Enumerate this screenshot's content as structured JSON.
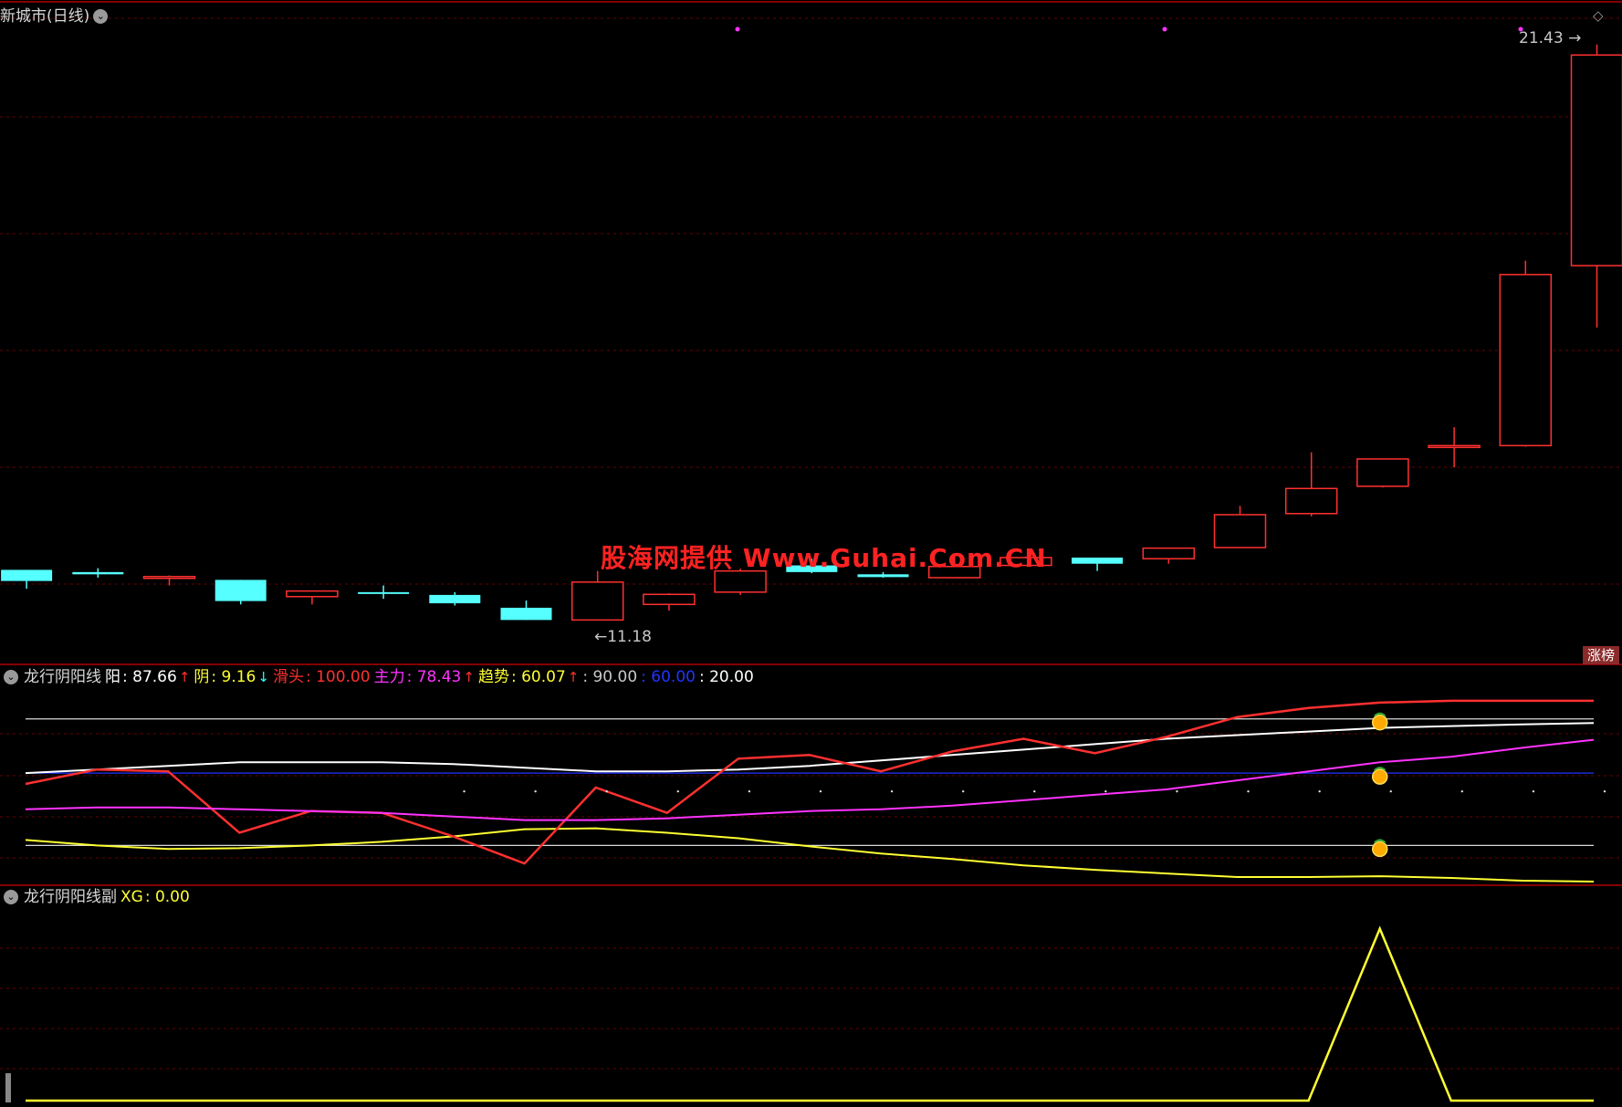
{
  "main": {
    "title": "新城市(日线)",
    "high_label": "21.43",
    "low_label": "←11.18",
    "watermark": "股海网提供 Www.Guhai.Com.CN",
    "badge": "涨榜"
  },
  "ind1": {
    "name": "龙行阴阳线",
    "items": [
      {
        "label": "阳",
        "value": "87.66",
        "arrow": "↑",
        "color": "#ffffff",
        "arrow_color": "#ff3030"
      },
      {
        "label": "阴",
        "value": "9.16",
        "arrow": "↓",
        "color": "#ffff33",
        "arrow_color": "#33ffff"
      },
      {
        "label": "滑头",
        "value": "100.00",
        "arrow": "",
        "color": "#ff3030",
        "arrow_color": "#ff3030"
      },
      {
        "label": "主力",
        "value": "78.43",
        "arrow": "↑",
        "color": "#ff33ff",
        "arrow_color": "#ff3030"
      },
      {
        "label": "趋势",
        "value": "60.07",
        "arrow": "↑",
        "color": "#ffff33",
        "arrow_color": "#ff3030"
      }
    ],
    "levels": [
      {
        "text": "90.00",
        "color": "#c8c8c8"
      },
      {
        "text": "60.00",
        "color": "#2233ff"
      },
      {
        "text": "20.00",
        "color": "#ffffff"
      }
    ]
  },
  "ind2": {
    "name": "龙行阴阳线副",
    "items": [
      {
        "label": "XG",
        "value": "0.00",
        "color": "#ffff33"
      }
    ]
  },
  "colors": {
    "up": "#ff3030",
    "down": "#55ffff",
    "grid": "#6a0000",
    "separator": "#b00000"
  },
  "chart_data": [
    {
      "type": "candlestick",
      "title": "新城市(日线)",
      "ylim": [
        10.5,
        21.9
      ],
      "annotations": [
        {
          "text": "21.43",
          "at": "max-high"
        },
        {
          "text": "11.18",
          "at": "min-low"
        }
      ],
      "candles": [
        {
          "o": 12.0,
          "h": 12.0,
          "l": 11.66,
          "c": 11.8
        },
        {
          "o": 11.96,
          "h": 12.03,
          "l": 11.86,
          "c": 11.92
        },
        {
          "o": 11.86,
          "h": 11.9,
          "l": 11.72,
          "c": 11.88
        },
        {
          "o": 11.82,
          "h": 11.82,
          "l": 11.38,
          "c": 11.44
        },
        {
          "o": 11.52,
          "h": 11.62,
          "l": 11.38,
          "c": 11.62
        },
        {
          "o": 11.6,
          "h": 11.72,
          "l": 11.48,
          "c": 11.58
        },
        {
          "o": 11.55,
          "h": 11.6,
          "l": 11.36,
          "c": 11.4
        },
        {
          "o": 11.32,
          "h": 11.45,
          "l": 11.1,
          "c": 11.1
        },
        {
          "o": 11.1,
          "h": 11.98,
          "l": 11.1,
          "c": 11.78
        },
        {
          "o": 11.38,
          "h": 11.58,
          "l": 11.27,
          "c": 11.56
        },
        {
          "o": 11.6,
          "h": 12.02,
          "l": 11.55,
          "c": 11.98
        },
        {
          "o": 12.08,
          "h": 12.2,
          "l": 11.94,
          "c": 11.96
        },
        {
          "o": 11.92,
          "h": 11.96,
          "l": 11.86,
          "c": 11.87
        },
        {
          "o": 11.86,
          "h": 12.26,
          "l": 11.86,
          "c": 12.06
        },
        {
          "o": 12.08,
          "h": 12.24,
          "l": 12.08,
          "c": 12.22
        },
        {
          "o": 12.22,
          "h": 12.22,
          "l": 11.98,
          "c": 12.11
        },
        {
          "o": 12.2,
          "h": 12.36,
          "l": 12.11,
          "c": 12.39
        },
        {
          "o": 12.4,
          "h": 13.15,
          "l": 12.4,
          "c": 12.99
        },
        {
          "o": 13.01,
          "h": 14.11,
          "l": 12.96,
          "c": 13.46
        },
        {
          "o": 13.5,
          "h": 13.98,
          "l": 13.48,
          "c": 13.99
        },
        {
          "o": 14.23,
          "h": 14.56,
          "l": 13.84,
          "c": 14.23
        },
        {
          "o": 14.23,
          "h": 17.55,
          "l": 14.21,
          "c": 17.3
        },
        {
          "o": 17.46,
          "h": 21.43,
          "l": 16.35,
          "c": 21.24
        }
      ]
    },
    {
      "type": "line",
      "title": "龙行阴阳线",
      "ylim": [
        0,
        105
      ],
      "reference_lines": [
        90,
        60,
        20
      ],
      "markers_at_index": 19,
      "series": [
        {
          "name": "阳",
          "color": "#ffffff",
          "values": [
            60,
            62,
            64,
            66,
            66,
            66,
            65,
            63,
            61,
            61,
            62,
            64,
            67,
            70,
            73,
            76,
            79,
            81,
            83,
            85,
            86,
            87,
            87.66
          ]
        },
        {
          "name": "阴",
          "color": "#ffff33",
          "values": [
            23,
            20,
            18,
            18.5,
            20,
            22,
            25,
            29,
            29.5,
            27,
            24,
            19.5,
            15.5,
            12.5,
            9,
            6.5,
            4.5,
            2.5,
            2.5,
            3,
            2,
            0.5,
            0
          ]
        },
        {
          "name": "滑头",
          "color": "#ff3030",
          "values": [
            54,
            62,
            61,
            27,
            39,
            38,
            25,
            10,
            52,
            38,
            68,
            70,
            61,
            72,
            79,
            71,
            80,
            91,
            96,
            99,
            100,
            100,
            100
          ]
        },
        {
          "name": "主力",
          "color": "#ff33ff",
          "values": [
            40,
            41,
            41,
            40,
            39,
            38,
            36,
            34,
            34,
            35,
            37,
            39,
            40,
            42,
            45,
            48,
            51,
            56,
            61,
            66,
            69,
            74,
            78.43
          ]
        },
        {
          "name": "趋势",
          "color": "#2233ff",
          "values": [
            60,
            60,
            60,
            60,
            60,
            60,
            60,
            60,
            60,
            60,
            60,
            60,
            60,
            60,
            60,
            60,
            60,
            60,
            60,
            60,
            60,
            60,
            60.07
          ]
        }
      ]
    },
    {
      "type": "line",
      "title": "龙行阴阳线副",
      "ylim": [
        0,
        1.12
      ],
      "series": [
        {
          "name": "XG",
          "color": "#ffff33",
          "values": [
            0,
            0,
            0,
            0,
            0,
            0,
            0,
            0,
            0,
            0,
            0,
            0,
            0,
            0,
            0,
            0,
            0,
            0,
            0,
            1,
            0,
            0,
            0
          ]
        }
      ]
    }
  ]
}
